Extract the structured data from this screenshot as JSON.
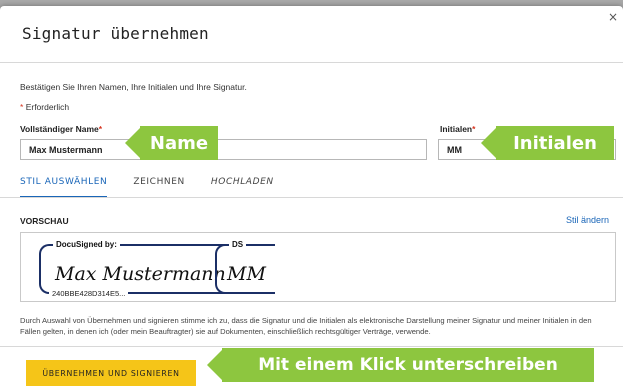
{
  "dialog": {
    "title": "Signatur übernehmen",
    "close_glyph": "×"
  },
  "form": {
    "instruction": "Bestätigen Sie Ihren Namen, Ihre Initialen und Ihre Signatur.",
    "required_note": "Erforderlich",
    "required_marker": "*",
    "full_name_label": "Vollständiger Name",
    "full_name_value": "Max Mustermann",
    "initials_label": "Initialen",
    "initials_value": "MM"
  },
  "tabs": [
    {
      "label": "STIL AUSWÄHLEN",
      "active": true
    },
    {
      "label": "ZEICHNEN",
      "active": false
    },
    {
      "label": "HOCHLADEN",
      "active": false
    }
  ],
  "preview": {
    "label": "VORSCHAU",
    "change_style_link": "Stil ändern",
    "signature_header": "DocuSigned by:",
    "signature_script": "Max Mustermann",
    "signature_id": "240BBE428D314E5...",
    "initials_header": "DS",
    "initials_script": "MM"
  },
  "consent_text": "Durch Auswahl von Übernehmen und signieren stimme ich zu, dass die Signatur und die Initialen als elektronische Darstellung meiner Signatur und meiner Initialen in den Fällen gelten, in denen ich (oder mein Beauftragter) sie auf Dokumenten, einschließlich rechtsgültiger Verträge, verwende.",
  "actions": {
    "adopt_and_sign": "ÜBERNEHMEN UND SIGNIEREN"
  },
  "callouts": {
    "name": "Name",
    "initials": "Initialen",
    "one_click": "Mit einem Klick unterschreiben"
  },
  "colors": {
    "accent_blue": "#1a66b8",
    "callout_green": "#8dc63f",
    "primary_button": "#f5c518",
    "required_red": "#d6341f",
    "signature_frame": "#1b2f66"
  }
}
